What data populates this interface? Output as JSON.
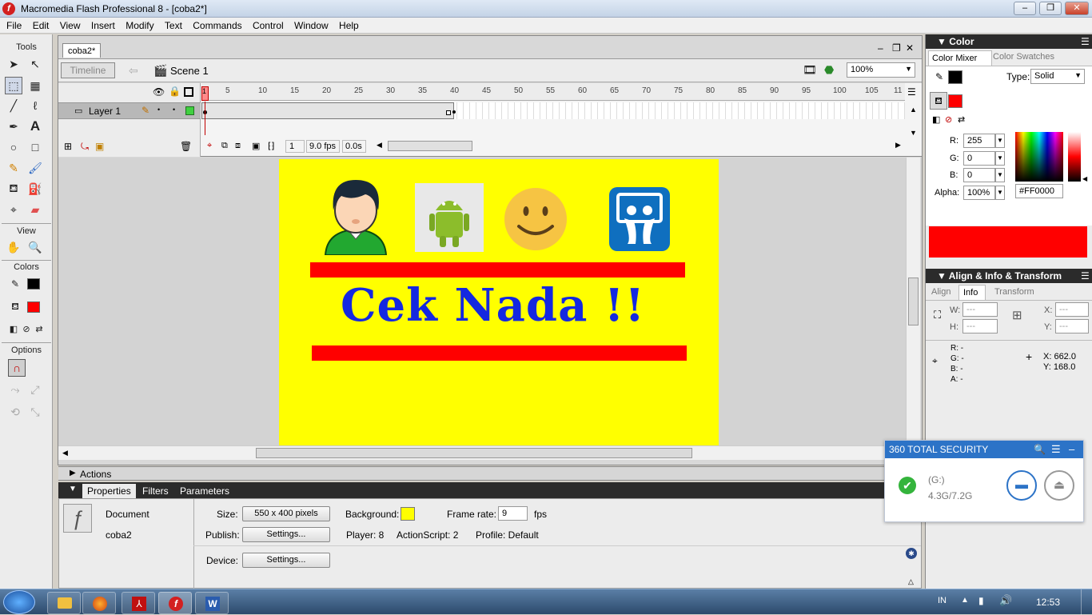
{
  "window": {
    "title": "Macromedia Flash Professional 8 - [coba2*]",
    "buttons": [
      "–",
      "❐",
      "✕"
    ]
  },
  "menu": [
    "File",
    "Edit",
    "View",
    "Insert",
    "Modify",
    "Text",
    "Commands",
    "Control",
    "Window",
    "Help"
  ],
  "tools": {
    "title": "Tools",
    "view_label": "View",
    "colors_label": "Colors",
    "options_label": "Options"
  },
  "document": {
    "tab": "coba2*",
    "timeline_button": "Timeline",
    "scene": "Scene 1",
    "zoom": "100%",
    "layer_name": "Layer 1",
    "frame_numbers": [
      "1",
      "5",
      "10",
      "15",
      "20",
      "25",
      "30",
      "35",
      "40",
      "45",
      "50",
      "55",
      "60",
      "65",
      "70",
      "75",
      "80",
      "85",
      "90",
      "95",
      "100",
      "105",
      "11"
    ],
    "current_frame": "1",
    "fps": "9.0 fps",
    "elapsed": "0.0s"
  },
  "stage": {
    "title": "Cek Nada !!",
    "background": "#ffff00",
    "bar_color": "#ff0000",
    "title_color": "#1428e0"
  },
  "actions_label": "Actions",
  "properties": {
    "tabs": [
      "Properties",
      "Filters",
      "Parameters"
    ],
    "doc_type": "Document",
    "doc_name": "coba2",
    "size_label": "Size:",
    "size_value": "550 x 400 pixels",
    "background_label": "Background:",
    "frame_rate_label": "Frame rate:",
    "frame_rate": "9",
    "fps_unit": "fps",
    "publish_label": "Publish:",
    "settings": "Settings...",
    "player": "Player: 8",
    "actionscript": "ActionScript:  2",
    "profile": "Profile:  Default",
    "device_label": "Device:"
  },
  "color_panel": {
    "title": "Color",
    "tabs": [
      "Color Mixer",
      "Color Swatches"
    ],
    "type_label": "Type:",
    "type_value": "Solid",
    "r_label": "R:",
    "r": "255",
    "g_label": "G:",
    "g": "0",
    "b_label": "B:",
    "b": "0",
    "alpha_label": "Alpha:",
    "alpha": "100%",
    "hex": "#FF0000",
    "fill_color": "#ff0000",
    "stroke_color": "#000000"
  },
  "info_panel": {
    "title": "Align & Info & Transform",
    "tabs": [
      "Align",
      "Info",
      "Transform"
    ],
    "w_label": "W:",
    "w": "---",
    "h_label": "H:",
    "h": "---",
    "x_label": "X:",
    "x": "---",
    "y_label": "Y:",
    "y": "---",
    "r_line": "R:  -",
    "g_line": "G:  -",
    "b_line": "B:  -",
    "a_line": "A:  -",
    "cursor_x": "X:  662.0",
    "cursor_y": "Y:  168.0"
  },
  "security_popup": {
    "title": "360 TOTAL SECURITY",
    "drive": "(G:)",
    "usage": "4.3G/7.2G"
  },
  "taskbar": {
    "lang": "IN",
    "time": "12:53"
  }
}
